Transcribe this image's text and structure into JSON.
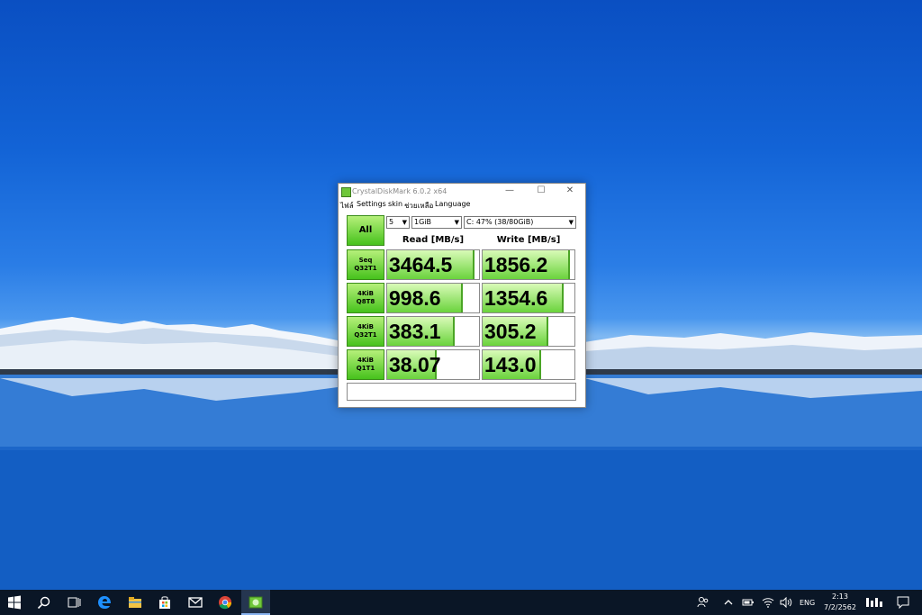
{
  "window": {
    "title": "CrystalDiskMark 6.0.2 x64",
    "menu": [
      "ไฟล์",
      "Settings",
      "skin",
      "ช่วยเหลือ",
      "Language"
    ],
    "controls": {
      "minimize": "—",
      "maximize": "☐",
      "close": "✕"
    }
  },
  "toolbar": {
    "all_label": "All",
    "count": "5",
    "size": "1GiB",
    "drive": "C: 47% (38/80GiB)"
  },
  "headers": {
    "read": "Read [MB/s]",
    "write": "Write [MB/s]"
  },
  "tests": [
    {
      "label1": "Seq",
      "label2": "Q32T1",
      "read": "3464.5",
      "write": "1856.2",
      "read_fill": 0.93,
      "write_fill": 0.93
    },
    {
      "label1": "4KiB",
      "label2": "Q8T8",
      "read": "998.6",
      "write": "1354.6",
      "read_fill": 0.8,
      "write_fill": 0.86
    },
    {
      "label1": "4KiB",
      "label2": "Q32T1",
      "read": "383.1",
      "write": "305.2",
      "read_fill": 0.72,
      "write_fill": 0.7
    },
    {
      "label1": "4KiB",
      "label2": "Q1T1",
      "read": "38.07",
      "write": "143.0",
      "read_fill": 0.52,
      "write_fill": 0.62
    }
  ],
  "comment": "",
  "taskbar": {
    "apps": [
      "start-icon",
      "search-icon",
      "task-view-icon",
      "edge-icon",
      "file-explorer-icon",
      "store-icon",
      "mail-icon",
      "chrome-icon",
      "crystaldiskmark-icon"
    ],
    "language": "ENG",
    "time": "2:13",
    "date": "7/2/2562"
  },
  "colors": {
    "accent_green": "#46c21c",
    "bar_green": "#6ad33c",
    "taskbar_bg": "#0a1626",
    "wallpaper_sky": "#1263d6"
  }
}
